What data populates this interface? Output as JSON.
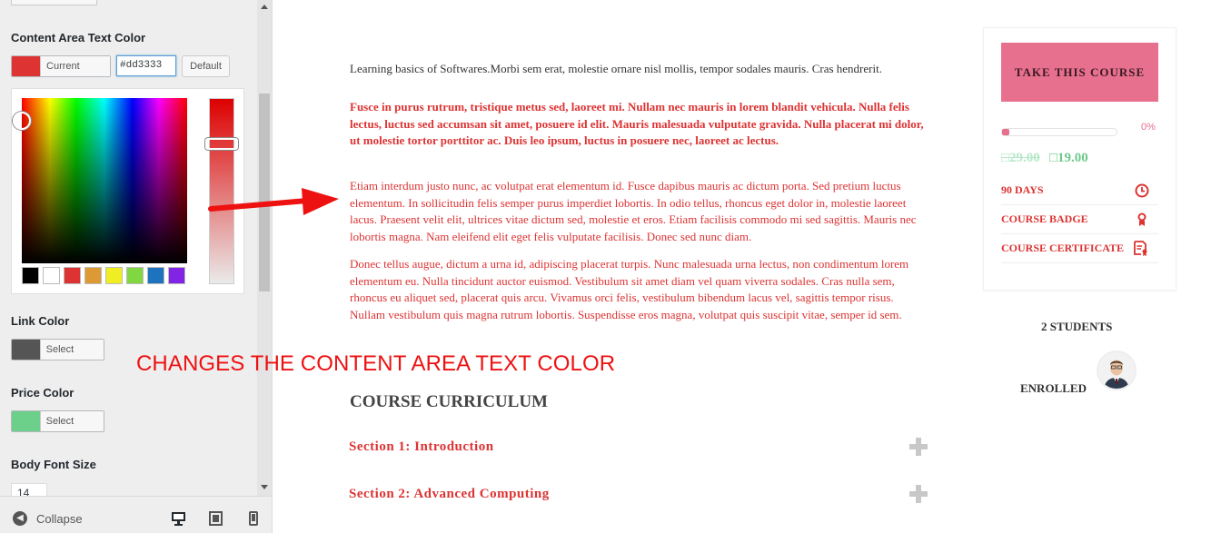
{
  "customizer": {
    "content_text_color_title": "Content Area Text Color",
    "current_color_label": "Current Color",
    "hex_value": "#dd3333",
    "default_label": "Default",
    "current_color": "#dd3333",
    "palette": [
      "#000000",
      "#ffffff",
      "#dd3333",
      "#dd9933",
      "#eeee22",
      "#81d742",
      "#1e73be",
      "#8224e3"
    ],
    "link_color_title": "Link Color",
    "link_color_value": "#555555",
    "select_color_label": "Select Color",
    "price_color_title": "Price Color",
    "price_color_value": "#6ccf8a",
    "body_font_size_title": "Body Font Size",
    "body_font_size_value": "14",
    "collapse_label": "Collapse"
  },
  "content": {
    "paragraph_1": "Learning basics of Softwares.Morbi sem erat, molestie ornare nisl mollis, tempor sodales mauris. Cras hendrerit.",
    "paragraph_2": "Fusce in purus rutrum, tristique metus sed, laoreet mi. Nullam nec mauris in lorem blandit vehicula. Nulla felis lectus, luctus sed accumsan sit amet, posuere id elit. Mauris malesuada vulputate gravida. Nulla placerat mi dolor, ut molestie tortor porttitor ac. Duis leo ipsum, luctus in posuere nec, laoreet ac lectus.",
    "paragraph_3": "Etiam interdum justo nunc, ac volutpat erat elementum id. Fusce dapibus mauris ac dictum porta. Sed pretium luctus elementum. In sollicitudin felis semper purus imperdiet lobortis. In odio tellus, rhoncus eget dolor in, molestie laoreet lacus. Praesent velit elit, ultrices vitae dictum sed, molestie et eros. Etiam facilisis commodo mi sed sagittis. Mauris nec lobortis magna. Nam eleifend elit eget felis vulputate facilisis. Donec sed nunc diam.",
    "paragraph_4": "Donec tellus augue, dictum a urna id, adipiscing placerat turpis. Nunc malesuada urna lectus, non condimentum lorem elementum eu. Nulla tincidunt auctor euismod. Vestibulum sit amet diam vel quam viverra sodales. Cras nulla sem, rhoncus eu aliquet sed, placerat quis arcu. Vivamus orci felis, vestibulum bibendum lacus vel, sagittis tempor risus. Nullam vestibulum quis magna rutrum lobortis. Suspendisse eros magna, volutpat quis suscipit vitae, semper id sem.",
    "annotation": "CHANGES THE CONTENT AREA TEXT COLOR",
    "curriculum_title": "COURSE CURRICULUM",
    "sections": [
      "Section 1: Introduction",
      "Section 2: Advanced Computing"
    ]
  },
  "sidebar": {
    "take_course_label": "TAKE THIS COURSE",
    "progress_percent": 0,
    "progress_label": "0%",
    "price_old": "□29.00",
    "price_new": "□19.00",
    "meta": [
      {
        "label": "90 DAYS",
        "icon": "clock-icon"
      },
      {
        "label": "COURSE BADGE",
        "icon": "badge-icon"
      },
      {
        "label": "COURSE CERTIFICATE",
        "icon": "certificate-icon"
      }
    ],
    "students_label": "2 STUDENTS",
    "enrolled_label": "ENROLLED"
  },
  "colors": {
    "accent_pink": "#e8708f",
    "content_text": "#dd3333",
    "price_green": "#6cc98a",
    "annotation_red": "#ee1111"
  }
}
